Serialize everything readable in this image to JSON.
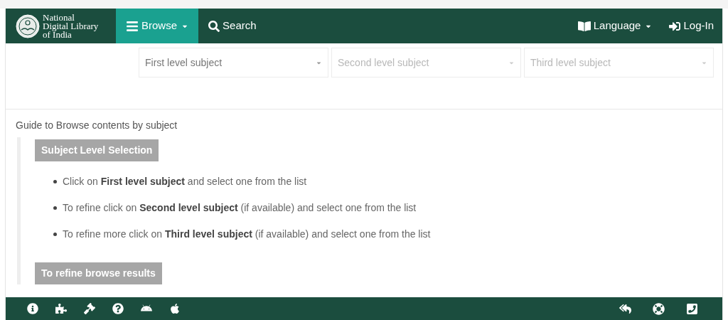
{
  "logo": {
    "lines": [
      "National",
      "Digital Library",
      "of India"
    ]
  },
  "nav": {
    "items": [
      {
        "label": "Browse",
        "selected": true,
        "kind": "menu"
      },
      {
        "label": "Search",
        "selected": false,
        "kind": "search"
      }
    ],
    "right": [
      {
        "label": "Language",
        "kind": "language"
      },
      {
        "label": "Log-In",
        "kind": "login"
      }
    ]
  },
  "subject_selects": [
    {
      "placeholder": "First level subject",
      "disabled": false
    },
    {
      "placeholder": "Second level subject",
      "disabled": true
    },
    {
      "placeholder": "Third level subject",
      "disabled": true
    }
  ],
  "guide": {
    "title": "Guide to Browse contents by subject",
    "sections": [
      {
        "heading": "Subject Level Selection",
        "bullets": [
          "Click on **First level subject** and select one from the list",
          "To refine click on **Second level subject** (if available) and select one from the list",
          "To refine more click on **Third level subject** (if available) and select one from the list"
        ]
      },
      {
        "heading": "To refine browse results"
      }
    ]
  }
}
